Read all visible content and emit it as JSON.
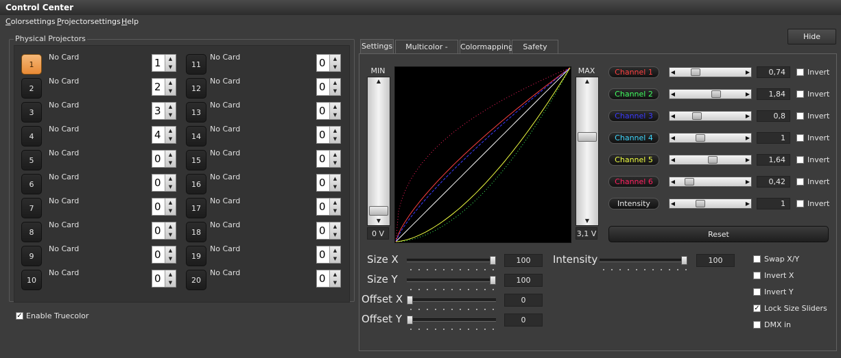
{
  "window": {
    "title": "Control Center"
  },
  "menu": [
    "Colorsettings",
    "Projectorsettings",
    "Help"
  ],
  "projectors": {
    "group_label": "Physical Projectors",
    "left": [
      {
        "num": "1",
        "label": "No Card",
        "value": "1"
      },
      {
        "num": "2",
        "label": "No Card",
        "value": "2"
      },
      {
        "num": "3",
        "label": "No Card",
        "value": "3"
      },
      {
        "num": "4",
        "label": "No Card",
        "value": "4"
      },
      {
        "num": "5",
        "label": "No Card",
        "value": "0"
      },
      {
        "num": "6",
        "label": "No Card",
        "value": "0"
      },
      {
        "num": "7",
        "label": "No Card",
        "value": "0"
      },
      {
        "num": "8",
        "label": "No Card",
        "value": "0"
      },
      {
        "num": "9",
        "label": "No Card",
        "value": "0"
      },
      {
        "num": "10",
        "label": "No Card",
        "value": "0"
      }
    ],
    "right": [
      {
        "num": "11",
        "label": "No Card",
        "value": "0"
      },
      {
        "num": "12",
        "label": "No Card",
        "value": "0"
      },
      {
        "num": "13",
        "label": "No Card",
        "value": "0"
      },
      {
        "num": "14",
        "label": "No Card",
        "value": "0"
      },
      {
        "num": "15",
        "label": "No Card",
        "value": "0"
      },
      {
        "num": "16",
        "label": "No Card",
        "value": "0"
      },
      {
        "num": "17",
        "label": "No Card",
        "value": "0"
      },
      {
        "num": "18",
        "label": "No Card",
        "value": "0"
      },
      {
        "num": "19",
        "label": "No Card",
        "value": "0"
      },
      {
        "num": "20",
        "label": "No Card",
        "value": "0"
      }
    ],
    "active": "1",
    "enable_truecolor": {
      "label": "Enable Truecolor",
      "checked": true
    }
  },
  "hide_label": "Hide",
  "tabs": [
    "Settings",
    "Multicolor - Setup",
    "Colormapping",
    "Safety Zone"
  ],
  "active_tab": "Settings",
  "voltage": {
    "min_label": "MIN",
    "max_label": "MAX",
    "min_value": "0 V",
    "max_value": "3,1 V",
    "min_level": 0.0,
    "max_level": 0.62
  },
  "channels": [
    {
      "label": "Channel 1",
      "color": "#ff4040",
      "value": "0,74",
      "level": 0.24,
      "invert_label": "Invert"
    },
    {
      "label": "Channel 2",
      "color": "#40ff60",
      "value": "1,84",
      "level": 0.59,
      "invert_label": "Invert"
    },
    {
      "label": "Channel 3",
      "color": "#3a3aff",
      "value": "0,8",
      "level": 0.26,
      "invert_label": "Invert"
    },
    {
      "label": "Channel 4",
      "color": "#40d8ff",
      "value": "1",
      "level": 0.32,
      "invert_label": "Invert"
    },
    {
      "label": "Channel 5",
      "color": "#f0ff40",
      "value": "1,64",
      "level": 0.53,
      "invert_label": "Invert"
    },
    {
      "label": "Channel 6",
      "color": "#ff2060",
      "value": "0,42",
      "level": 0.14,
      "invert_label": "Invert"
    },
    {
      "label": "Intensity",
      "color": "#e8e8e8",
      "value": "1",
      "level": 0.32,
      "invert_label": "Invert"
    }
  ],
  "reset_label": "Reset",
  "size_offset": [
    {
      "label": "Size X",
      "value": "100",
      "level": 1.0
    },
    {
      "label": "Size Y",
      "value": "100",
      "level": 1.0
    },
    {
      "label": "Offset X",
      "value": "0",
      "level": 0.0
    },
    {
      "label": "Offset Y",
      "value": "0",
      "level": 0.0
    }
  ],
  "intensity": {
    "label": "Intensity",
    "value": "100",
    "level": 1.0
  },
  "options": [
    {
      "label": "Swap X/Y",
      "checked": false
    },
    {
      "label": "Invert X",
      "checked": false
    },
    {
      "label": "Invert Y",
      "checked": false
    },
    {
      "label": "Lock Size Sliders",
      "checked": true
    },
    {
      "label": "DMX in",
      "checked": false
    }
  ],
  "curve_colors": {
    "channel_1": "#ff4040",
    "channel_2": "#40ff60",
    "channel_3": "#3a3aff",
    "channel_4": "#40d8ff",
    "channel_5": "#f0ff40",
    "channel_6": "#ff2060",
    "intensity": "#ffffff"
  }
}
